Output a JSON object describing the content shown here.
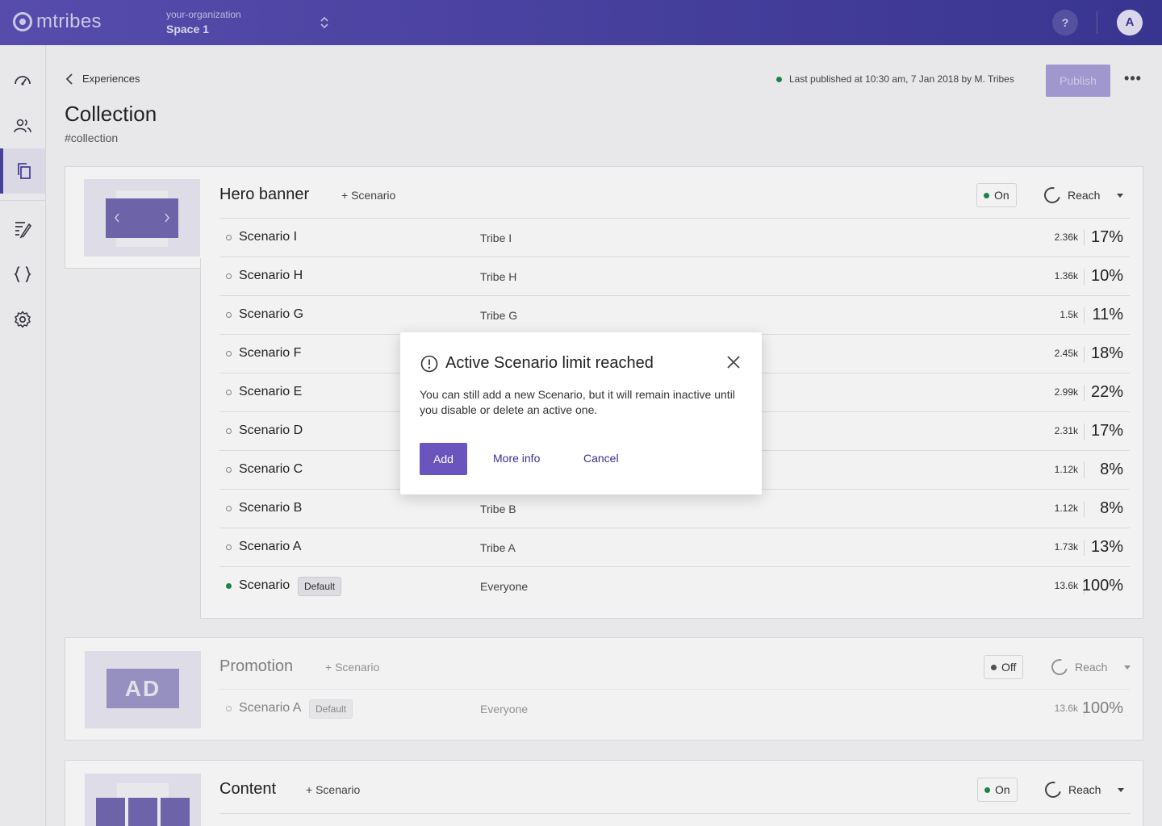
{
  "header": {
    "logo": "mtribes",
    "org_name": "your-organization",
    "space": "Space 1",
    "help": "?",
    "avatar": "A"
  },
  "sidebar": {
    "items": [
      {
        "icon": "dashboard-icon",
        "active": false
      },
      {
        "icon": "tribes-icon",
        "active": false
      },
      {
        "icon": "experiences-icon",
        "active": true
      },
      {
        "icon": "templates-icon",
        "active": false
      },
      {
        "icon": "code-icon",
        "active": false
      },
      {
        "icon": "settings-icon",
        "active": false
      }
    ]
  },
  "page": {
    "breadcrumb": "Experiences",
    "title": "Collection",
    "slug": "#collection",
    "published_status": "Last published at 10:30 am, 7 Jan 2018 by M. Tribes",
    "publish_label": "Publish",
    "more": "•••"
  },
  "experiences": [
    {
      "name": "Hero banner",
      "add_scenario": "+ Scenario",
      "toggle": "On",
      "reach_label": "Reach",
      "scenarios": [
        {
          "name": "Scenario I",
          "tribe": "Tribe I",
          "count": "2.36k",
          "pct": "17%"
        },
        {
          "name": "Scenario H",
          "tribe": "Tribe H",
          "count": "1.36k",
          "pct": "10%"
        },
        {
          "name": "Scenario G",
          "tribe": "Tribe G",
          "count": "1.5k",
          "pct": "11%"
        },
        {
          "name": "Scenario F",
          "tribe": "",
          "count": "2.45k",
          "pct": "18%"
        },
        {
          "name": "Scenario E",
          "tribe": "",
          "count": "2.99k",
          "pct": "22%"
        },
        {
          "name": "Scenario D",
          "tribe": "",
          "count": "2.31k",
          "pct": "17%"
        },
        {
          "name": "Scenario C",
          "tribe": "",
          "count": "1.12k",
          "pct": "8%"
        },
        {
          "name": "Scenario B",
          "tribe": "Tribe B",
          "count": "1.12k",
          "pct": "8%"
        },
        {
          "name": "Scenario A",
          "tribe": "Tribe A",
          "count": "1.73k",
          "pct": "13%"
        },
        {
          "name": "Scenario",
          "badge": "Default",
          "tribe": "Everyone",
          "count": "13.6k",
          "pct": "100%",
          "active": true
        }
      ]
    },
    {
      "name": "Promotion",
      "add_scenario": "+ Scenario",
      "toggle": "Off",
      "reach_label": "Reach",
      "thumb_text": "AD",
      "scenarios": [
        {
          "name": "Scenario A",
          "badge": "Default",
          "tribe": "Everyone",
          "count": "13.6k",
          "pct": "100%"
        }
      ]
    },
    {
      "name": "Content",
      "add_scenario": "+ Scenario",
      "toggle": "On",
      "reach_label": "Reach"
    }
  ],
  "modal": {
    "title": "Active Scenario limit reached",
    "body": "You can still add a new Scenario, but it will remain inactive until you disable or delete an active one.",
    "add": "Add",
    "more_info": "More info",
    "cancel": "Cancel"
  },
  "colors": {
    "brand": "#4b43a1",
    "primary_button": "#6a55bf",
    "status_green": "#1c8a4a"
  }
}
